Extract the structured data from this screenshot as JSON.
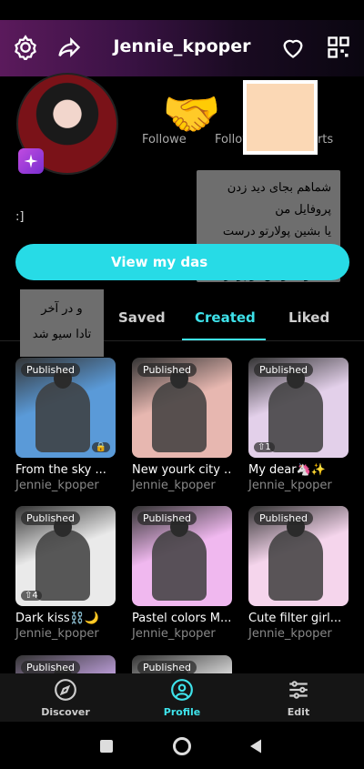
{
  "header": {
    "title": "Jennie_kpoper"
  },
  "profile": {
    "followers_label": "Followe",
    "following_label": "Follow",
    "reports_label": "orts",
    "bio": ":]"
  },
  "notes": {
    "note1": [
      "شماهم بجای دید زدن",
      "پروفایل من",
      "یا بشین پولارتو درست کن",
      "یا منو فالو کن تو پولار"
    ],
    "note2": [
      "و در آخر",
      "تادا سیو شد"
    ]
  },
  "dashboard_button": "View my das",
  "tabs": {
    "saved": "Saved",
    "created": "Created",
    "liked": "Liked"
  },
  "cards": [
    {
      "badge": "Published",
      "title": "From the sky ...",
      "author": "Jennie_kpoper",
      "meta": "🔒",
      "color": "#5a9ad8"
    },
    {
      "badge": "Published",
      "title": "New yourk city ...",
      "author": "Jennie_kpoper",
      "meta": "",
      "color": "#e7b7b0"
    },
    {
      "badge": "Published",
      "title": "My dear🦄✨",
      "author": "Jennie_kpoper",
      "meta": "⇧1",
      "color": "#e3d0ea"
    },
    {
      "badge": "Published",
      "title": "Dark kiss⛓️🌙",
      "author": "Jennie_kpoper",
      "meta": "⇧4",
      "color": "#eaeaea"
    },
    {
      "badge": "Published",
      "title": "Pastel colors M...",
      "author": "Jennie_kpoper",
      "meta": "",
      "color": "#f0b8ef"
    },
    {
      "badge": "Published",
      "title": "Cute filter girl...",
      "author": "Jennie_kpoper",
      "meta": "",
      "color": "#f5d5ec"
    },
    {
      "badge": "Published",
      "title": "",
      "author": "",
      "meta": "",
      "color": "#c7a6e6"
    },
    {
      "badge": "Published",
      "title": "",
      "author": "",
      "meta": "",
      "color": "#e8e8e8"
    }
  ],
  "nav": {
    "discover": "Discover",
    "profile": "Profile",
    "edit": "Edit"
  },
  "colors": {
    "accent": "#3ee2ea",
    "button": "#27dbe6"
  }
}
